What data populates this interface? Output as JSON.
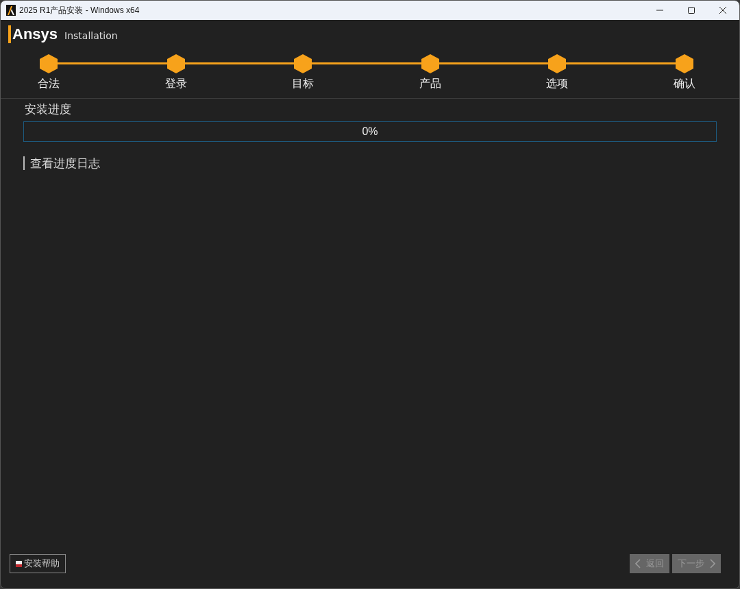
{
  "window": {
    "title": "2025 R1产品安装 - Windows x64"
  },
  "header": {
    "brand": "Ansys",
    "subtitle": "Installation"
  },
  "steps": [
    {
      "label": "合法",
      "completed": true
    },
    {
      "label": "登录",
      "completed": true
    },
    {
      "label": "目标",
      "completed": true
    },
    {
      "label": "产品",
      "completed": true
    },
    {
      "label": "选项",
      "completed": true
    },
    {
      "label": "确认",
      "completed": true
    }
  ],
  "progress": {
    "title": "安装进度",
    "level": 0,
    "reading": "0%"
  },
  "log_link": {
    "label": "查看进度日志"
  },
  "footer": {
    "help": {
      "label": "安装帮助"
    },
    "back": {
      "label": "返回",
      "disabled": true
    },
    "next": {
      "label": "下一步",
      "disabled": true
    }
  }
}
